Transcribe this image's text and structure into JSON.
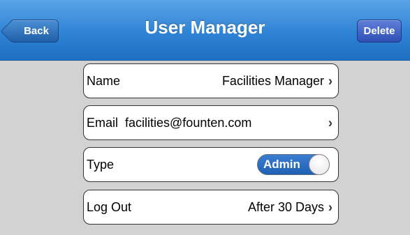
{
  "navbar": {
    "title": "User Manager",
    "back_label": "Back",
    "delete_label": "Delete"
  },
  "rows": {
    "name": {
      "label": "Name",
      "value": "Facilities Manager",
      "icon": "chevron-right-icon"
    },
    "email": {
      "label": "Email",
      "value": "facilities@founten.com",
      "icon": "chevron-right-icon"
    },
    "type": {
      "label": "Type",
      "toggle_label": "Admin",
      "toggle_on": true
    },
    "logout": {
      "label": "Log Out",
      "value": "After 30 Days",
      "icon": "chevron-right-icon"
    }
  },
  "colors": {
    "navbar": "#2f83d5",
    "background": "#d2d2d2",
    "toggle_on": "#1f60b5"
  }
}
